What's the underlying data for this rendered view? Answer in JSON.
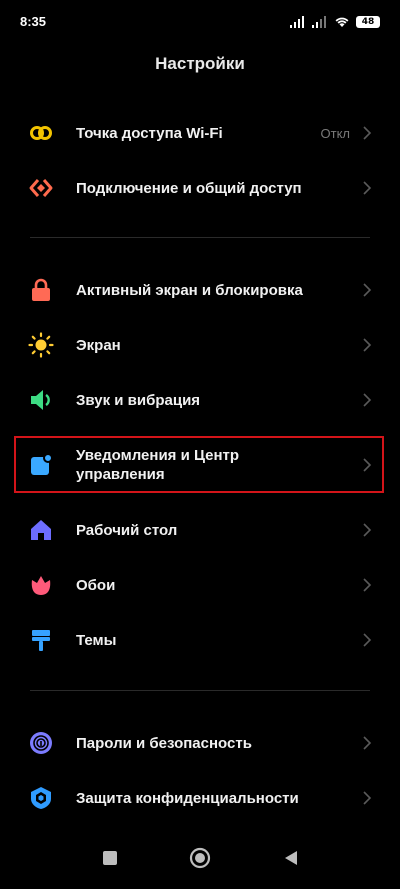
{
  "status": {
    "time": "8:35",
    "battery": "48"
  },
  "header": {
    "title": "Настройки"
  },
  "settings": {
    "hotspot": {
      "label": "Точка доступа Wi-Fi",
      "value": "Откл"
    },
    "connection": {
      "label": "Подключение и общий доступ"
    },
    "lockscreen": {
      "label": "Активный экран и блокировка"
    },
    "display": {
      "label": "Экран"
    },
    "sound": {
      "label": "Звук и вибрация"
    },
    "notifications": {
      "label_line1": "Уведомления и Центр",
      "label_line2": "управления"
    },
    "home": {
      "label": "Рабочий стол"
    },
    "wallpaper": {
      "label": "Обои"
    },
    "themes": {
      "label": "Темы"
    },
    "passwords": {
      "label": "Пароли и безопасность"
    },
    "privacy": {
      "label": "Защита конфиденциальности"
    }
  },
  "colors": {
    "hotspot": "#f2c300",
    "connection": "#ff6a4d",
    "lock": "#ff6a55",
    "display": "#ffcc33",
    "sound": "#3ddc84",
    "notifications": "#3aa8ff",
    "home": "#6d6dff",
    "wallpaper": "#ff5a7a",
    "themes": "#36a2ff",
    "passwords": "#7c7cff",
    "privacy": "#2f9bff",
    "highlight": "#d31419"
  },
  "icons": [
    "hotspot-icon",
    "connection-icon",
    "lock-icon",
    "display-icon",
    "sound-icon",
    "notifications-icon",
    "home-icon",
    "wallpaper-icon",
    "themes-icon",
    "passwords-icon",
    "privacy-icon"
  ]
}
